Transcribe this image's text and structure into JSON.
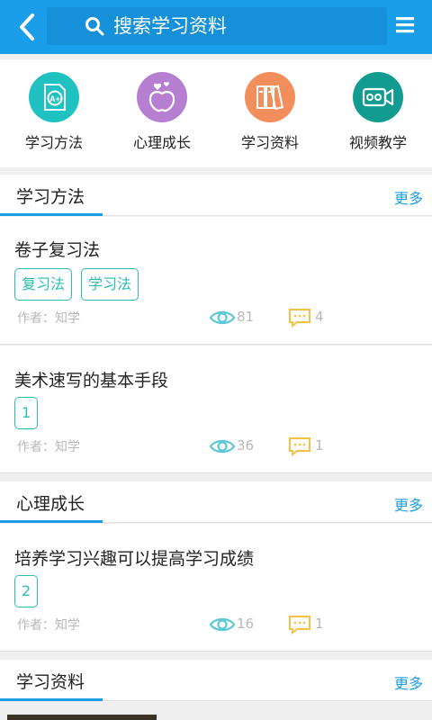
{
  "header": {
    "search_placeholder": "搜索学习资料"
  },
  "categories": [
    {
      "label": "学习方法",
      "color": "#1fc2c0",
      "icon": "grade-paper-icon"
    },
    {
      "label": "心理成长",
      "color": "#b77fd1",
      "icon": "apple-heart-icon"
    },
    {
      "label": "学习资料",
      "color": "#f28d5c",
      "icon": "binders-icon"
    },
    {
      "label": "视频教学",
      "color": "#129c8f",
      "icon": "video-camera-icon"
    }
  ],
  "sections": [
    {
      "title": "学习方法",
      "more": "更多",
      "articles": [
        {
          "title": "卷子复习法",
          "tags": [
            "复习法",
            "学习法"
          ],
          "author": "作者：知学",
          "views": "81",
          "comments": "4"
        },
        {
          "title": "美术速写的基本手段",
          "tags": [
            "1"
          ],
          "author": "作者：知学",
          "views": "36",
          "comments": "1"
        }
      ]
    },
    {
      "title": "心理成长",
      "more": "更多",
      "articles": [
        {
          "title": "培养学习兴趣可以提高学习成绩",
          "tags": [
            "2"
          ],
          "author": "作者：知学",
          "views": "16",
          "comments": "1"
        }
      ]
    },
    {
      "title": "学习资料",
      "more": "更多",
      "articles": []
    }
  ],
  "colors": {
    "primary": "#1a9ee9",
    "tag": "#2bbcb4",
    "eye": "#5ec9d6",
    "comment": "#f5c045"
  }
}
